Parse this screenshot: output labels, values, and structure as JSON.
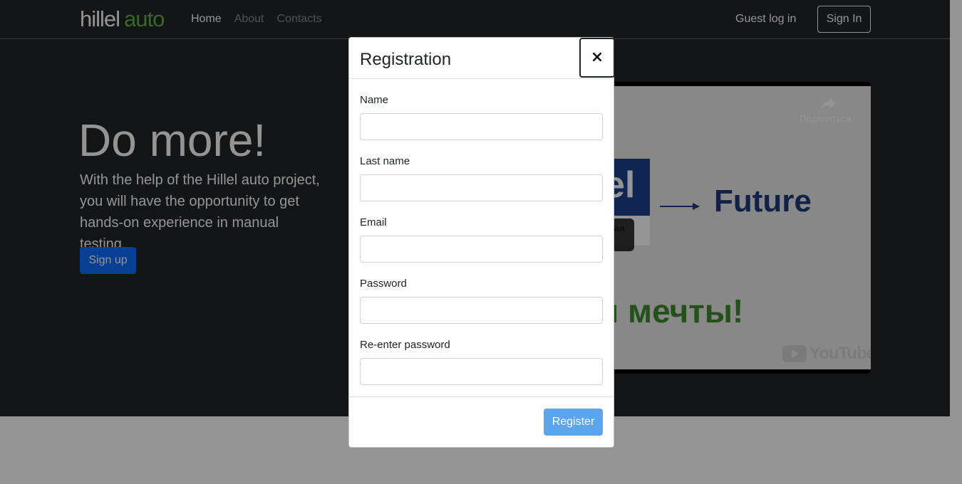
{
  "header": {
    "logo_part1": "hillel",
    "logo_part2": "auto",
    "nav": [
      "Home",
      "About",
      "Contacts"
    ],
    "guest_login": "Guest log in",
    "sign_in": "Sign In"
  },
  "hero": {
    "title": "Do more!",
    "text": "With the help of the Hillel auto project, you will have the opportunity to get hands-on experience in manual testing.",
    "signup": "Sign up"
  },
  "video": {
    "share": "Поделиться",
    "logo": "el",
    "logo_sub": "рная",
    "future": "Future",
    "dream": "и мечты!",
    "brand": "YouTube"
  },
  "modal": {
    "title": "Registration",
    "close": "×",
    "fields": [
      {
        "label": "Name",
        "value": ""
      },
      {
        "label": "Last name",
        "value": ""
      },
      {
        "label": "Email",
        "value": ""
      },
      {
        "label": "Password",
        "value": ""
      },
      {
        "label": "Re-enter password",
        "value": ""
      }
    ],
    "register": "Register"
  },
  "colors": {
    "dark_bg": "#212529",
    "brand_green": "#62b33b",
    "primary": "#0d6efd",
    "register_disabled": "#5aa5ee"
  }
}
